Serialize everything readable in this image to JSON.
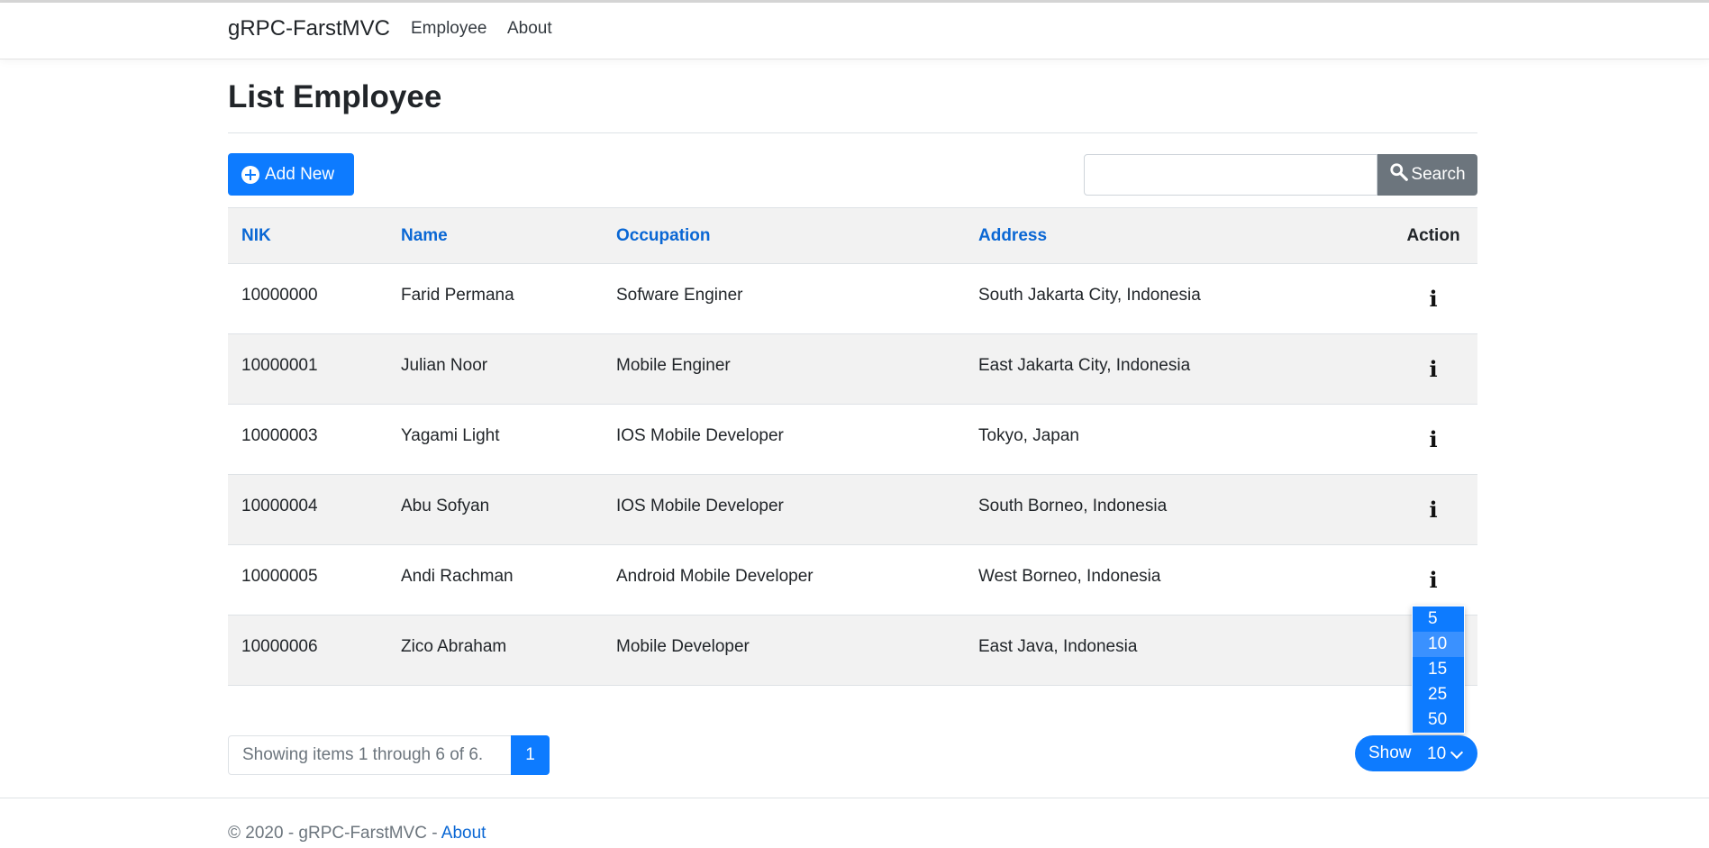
{
  "navbar": {
    "brand": "gRPC-FarstMVC",
    "links": [
      "Employee",
      "About"
    ]
  },
  "page": {
    "title": "List Employee"
  },
  "toolbar": {
    "add_label": "Add New",
    "search_value": "",
    "search_label": "Search"
  },
  "table": {
    "headers": [
      "NIK",
      "Name",
      "Occupation",
      "Address",
      "Action"
    ],
    "rows": [
      {
        "nik": "10000000",
        "name": "Farid Permana",
        "occupation": "Sofware Enginer",
        "address": "South Jakarta City, Indonesia"
      },
      {
        "nik": "10000001",
        "name": "Julian Noor",
        "occupation": "Mobile Enginer",
        "address": "East Jakarta City, Indonesia"
      },
      {
        "nik": "10000003",
        "name": "Yagami Light",
        "occupation": "IOS Mobile Developer",
        "address": "Tokyo, Japan"
      },
      {
        "nik": "10000004",
        "name": "Abu Sofyan",
        "occupation": "IOS Mobile Developer",
        "address": "South Borneo, Indonesia"
      },
      {
        "nik": "10000005",
        "name": "Andi Rachman",
        "occupation": "Android Mobile Developer",
        "address": "West Borneo, Indonesia"
      },
      {
        "nik": "10000006",
        "name": "Zico Abraham",
        "occupation": "Mobile Developer",
        "address": "East Java, Indonesia"
      }
    ],
    "action_icon": "info-icon"
  },
  "pagination": {
    "summary": "Showing items 1 through 6 of 6.",
    "current_page": "1"
  },
  "page_size": {
    "label": "Show",
    "selected": "10",
    "options": [
      "5",
      "10",
      "15",
      "25",
      "50"
    ]
  },
  "footer": {
    "text": "© 2020 - gRPC-FarstMVC - ",
    "link": "About"
  },
  "colors": {
    "primary": "#0d7bff",
    "header_link": "#0a67d4",
    "secondary": "#6c757d"
  }
}
